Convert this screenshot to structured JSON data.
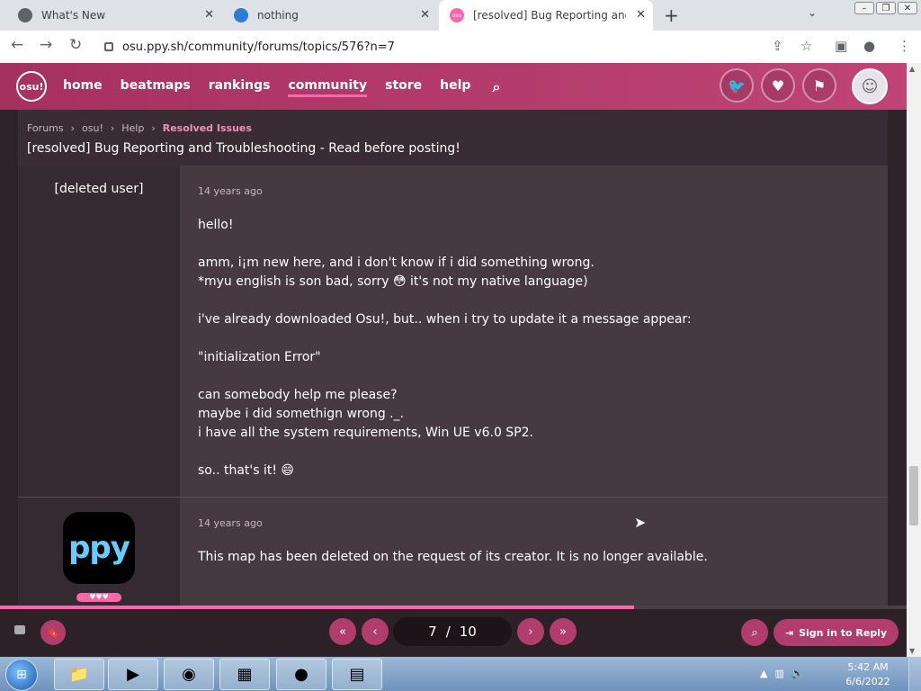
{
  "browser": {
    "tabs": [
      {
        "title": "What's New",
        "icon": "chrome-settings-icon"
      },
      {
        "title": "nothing",
        "icon": "tab-icon"
      },
      {
        "title": "[resolved] Bug Reporting and Tro",
        "icon": "osu-tab-icon",
        "active": true
      }
    ],
    "url": "osu.ppy.sh/community/forums/topics/576?n=7"
  },
  "osu_header": {
    "logo": "osu!",
    "nav": [
      {
        "label": "home"
      },
      {
        "label": "beatmaps"
      },
      {
        "label": "rankings"
      },
      {
        "label": "community",
        "active": true
      },
      {
        "label": "store"
      },
      {
        "label": "help"
      }
    ]
  },
  "breadcrumb": [
    "Forums",
    "osu!",
    "Help",
    "Resolved Issues"
  ],
  "topic_title": "[resolved] Bug Reporting and Troubleshooting - Read before posting!",
  "posts": [
    {
      "username": "[deleted user]",
      "time": "14 years ago",
      "lines": [
        "hello!",
        "",
        "amm, i¡m new here, and i don't know if i did something wrong.",
        "*myu english is son bad, sorry 😳 it's not my native language)",
        "",
        "i've already downloaded Osu!, but.. when i try to update it a message appear:",
        "",
        "\"initialization Error\"",
        "",
        "can somebody help me please?",
        "maybe i did somethign wrong ._.",
        "i have all the system requirements, Win UE v6.0 SP2.",
        "",
        "so.. that's it! 😄"
      ]
    },
    {
      "username": "",
      "avatar_text": "ppy",
      "time": "14 years ago",
      "lines": [
        "This map has been deleted on the request of its creator. It is no longer available."
      ]
    }
  ],
  "pagination": {
    "current": "7",
    "separator": "/",
    "total": "10"
  },
  "progress_fraction": 0.7,
  "sign_in_label": "Sign in to Reply",
  "taskbar": {
    "time": "5:42 AM",
    "date": "6/6/2022"
  },
  "colors": {
    "accent": "#ff66aa",
    "header": "#b6386c"
  }
}
